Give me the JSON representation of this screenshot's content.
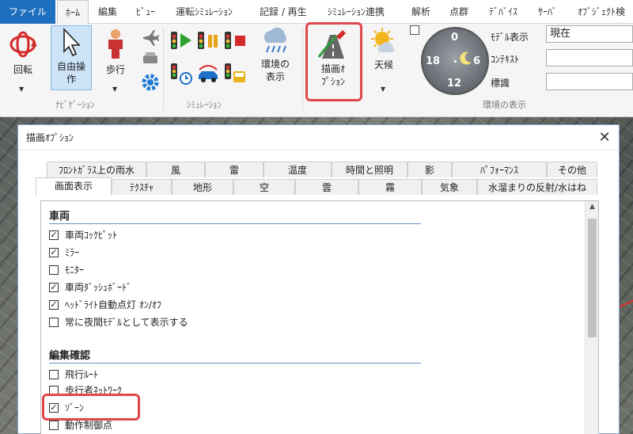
{
  "ribbon_tabs": [
    "ファイル",
    "ﾎｰﾑ",
    "編集",
    "ﾋﾞｭｰ",
    "運転ｼﾐｭﾚｰｼｮﾝ",
    "記録 / 再生",
    "ｼﾐｭﾚｰｼｮﾝ連携",
    "解析",
    "点群",
    "ﾃﾞﾊﾞｲｽ",
    "ｻｰﾊﾞ",
    "ｵﾌﾞｼﾞｪｸﾄ検"
  ],
  "ribbon": {
    "rotate": "回転",
    "free_op_1": "自由操",
    "free_op_2": "作",
    "walk": "歩行",
    "env_display_1": "環境の",
    "env_display_2": "表示",
    "draw_option_1": "描画ｵ",
    "draw_option_2": "ﾌﾟｼｮﾝ",
    "weather": "天候",
    "group_navigation": "ﾅﾋﾞｹﾞｰｼｮﾝ",
    "group_simulation": "ｼﾐｭﾚｰｼｮﾝ",
    "group_environment": "環境の表示",
    "model_display_label": "ﾓﾃﾞﾙ表示",
    "model_display_value": "現在",
    "context_label": "ｺﾝﾃｷｽﾄ",
    "sign_label": "標識",
    "clock_0": "0",
    "clock_6": "6",
    "clock_12": "12",
    "clock_18": "18"
  },
  "dialog": {
    "title": "描画ｵﾌﾟｼｮﾝ",
    "close": "✕",
    "tabs_row1": [
      "ﾌﾛﾝﾄｶﾞﾗｽ上の雨水",
      "風",
      "雷",
      "温度",
      "時間と照明",
      "影",
      "ﾊﾟﾌｫｰﾏﾝｽ",
      "その他"
    ],
    "tabs_row2": [
      "画面表示",
      "ﾃｸｽﾁｬ",
      "地形",
      "空",
      "雲",
      "霧",
      "気象",
      "水溜まりの反射/水はね"
    ],
    "sections": [
      {
        "heading": "車両",
        "items": [
          {
            "label": "車両ｺｯｸﾋﾟｯﾄ",
            "checked": true
          },
          {
            "label": "ﾐﾗｰ",
            "checked": true
          },
          {
            "label": "ﾓﾆﾀｰ",
            "checked": false
          },
          {
            "label": "車両ﾀﾞｯｼｭﾎﾞｰﾄﾞ",
            "checked": true
          },
          {
            "label": "ﾍｯﾄﾞﾗｲﾄ自動点灯 ｵﾝ/ｵﾌ",
            "checked": true
          },
          {
            "label": "常に夜間ﾓﾃﾞﾙとして表示する",
            "checked": false
          }
        ]
      },
      {
        "heading": "編集確認",
        "items": [
          {
            "label": "飛行ﾙｰﾄ",
            "checked": false
          },
          {
            "label": "歩行者ﾈｯﾄﾜｰｸ",
            "checked": false
          },
          {
            "label": "ｿﾞｰﾝ",
            "checked": true
          },
          {
            "label": "動作制御点",
            "checked": false
          }
        ]
      }
    ]
  },
  "colors": {
    "file_tab": "#1f6fbf",
    "highlight": "#e0474b",
    "section_rule": "#6a8cc8"
  }
}
